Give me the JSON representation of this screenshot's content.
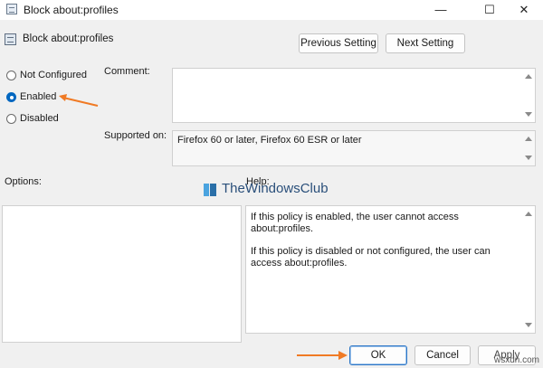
{
  "window": {
    "title": "Block about:profiles",
    "controls": [
      "minimize-icon",
      "maximize-icon",
      "close-icon"
    ]
  },
  "header": {
    "policy_name": "Block about:profiles",
    "prev_label": "Previous Setting",
    "next_label": "Next Setting"
  },
  "state": {
    "options": [
      {
        "label": "Not Configured",
        "checked": false
      },
      {
        "label": "Enabled",
        "checked": true
      },
      {
        "label": "Disabled",
        "checked": false
      }
    ]
  },
  "comment": {
    "label": "Comment:",
    "value": ""
  },
  "supported": {
    "label": "Supported on:",
    "value": "Firefox 60 or later, Firefox 60 ESR or later"
  },
  "options_pane": {
    "label": "Options:"
  },
  "help": {
    "label": "Help:",
    "para1": "If this policy is enabled, the user cannot access about:profiles.",
    "para2": "If this policy is disabled or not configured, the user can access about:profiles."
  },
  "watermark": {
    "text": "TheWindowsClub"
  },
  "footer": {
    "ok_label": "OK",
    "cancel_label": "Cancel",
    "apply_label": "Apply",
    "site_watermark": "wsxdn.com"
  },
  "colors": {
    "accent": "#0067c0",
    "annotation_arrow": "#f07a24"
  }
}
